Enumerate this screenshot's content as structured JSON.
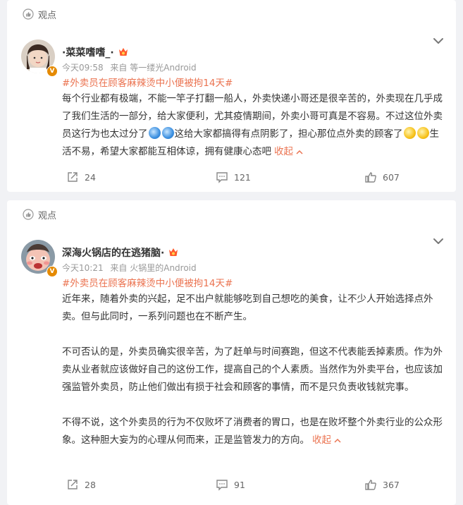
{
  "posts": [
    {
      "tag": "观点",
      "username": "·菜菜嗜嗜_·",
      "time": "今天09:58",
      "source": "来自 等一缕光Android",
      "topic": "#外卖员在顾客麻辣烫中小便被拘14天#",
      "text_parts": [
        "每个行业都有极端，不能一竿子打翻一船人，外卖快递小哥还是很辛苦的，外卖现在几乎成了我们生活的一部分，给大家便利，尤其疫情期间，外卖小哥可真是不容易。不过这位外卖员这行为也太过分了",
        "这给大家都搞得有点阴影了，担心那位点外卖的顾客了",
        "生活不易，希望大家都能互相体谅，拥有健康心态吧"
      ],
      "collapse": "收起",
      "shares": "24",
      "comments": "121",
      "likes": "607"
    },
    {
      "tag": "观点",
      "username": "深海火锅店的在逃猪脑·",
      "time": "今天10:21",
      "source": "来自 火锅里的Android",
      "topic": "#外卖员在顾客麻辣烫中小便被拘14天#",
      "paragraphs": [
        "近年来，随着外卖的兴起，足不出户就能够吃到自己想吃的美食，让不少人开始选择点外卖。但与此同时，一系列问题也在不断产生。",
        "不可否认的是，外卖员确实很辛苦，为了赶单与时间赛跑，但这不代表能丢掉素质。作为外卖从业者就应该做好自己的这份工作，提高自己的个人素质。当然作为外卖平台，也应该加强监管外卖员，防止他们做出有损于社会和顾客的事情，而不是只负责收钱就完事。",
        "不得不说，这个外卖员的行为不仅败坏了消费者的胃口，也是在败坏整个外卖行业的公众形象。这种胆大妄为的心理从何而来，正是监管发力的方向。"
      ],
      "collapse": "收起",
      "shares": "28",
      "comments": "91",
      "likes": "367"
    }
  ],
  "icons": {
    "tag": "thumbs-up-circle-icon",
    "menu": "chevron-down-icon",
    "share": "share-icon",
    "comment": "comment-icon",
    "like": "like-icon"
  },
  "colors": {
    "accent": "#eb7350",
    "badge": "#e58a00",
    "muted": "#999999"
  }
}
